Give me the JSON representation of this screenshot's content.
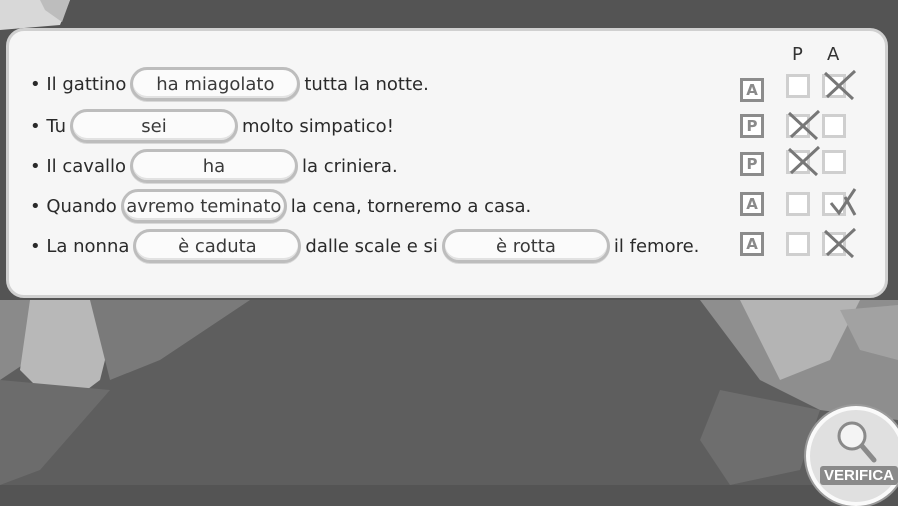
{
  "columns": {
    "p": "P",
    "a": "A"
  },
  "rows": [
    {
      "parts": [
        "• Il gattino",
        "ha miagolato",
        "tutta la notte."
      ],
      "badge": "A",
      "p_checked": false,
      "a_checked": true
    },
    {
      "parts": [
        "• Tu",
        "sei",
        "molto simpatico!"
      ],
      "badge": "P",
      "p_checked": true,
      "a_checked": false
    },
    {
      "parts": [
        "• Il cavallo",
        "ha",
        "la criniera."
      ],
      "badge": "P",
      "p_checked": true,
      "a_checked": false
    },
    {
      "parts": [
        "• Quando",
        "avremo teminato",
        "la cena, torneremo a casa."
      ],
      "badge": "A",
      "p_checked": false,
      "a_checked": true
    },
    {
      "parts": [
        "• La nonna",
        "è caduta",
        "dalle scale e si",
        "è rotta",
        "il femore."
      ],
      "badge": "A",
      "p_checked": false,
      "a_checked": true
    }
  ],
  "verify_button": {
    "label": "VERIFICA",
    "icon": "magnifier-icon"
  },
  "colors": {
    "background": "#545454",
    "card": "#f6f6f6",
    "pill_border": "#bdbdbd",
    "check": "#777777"
  }
}
